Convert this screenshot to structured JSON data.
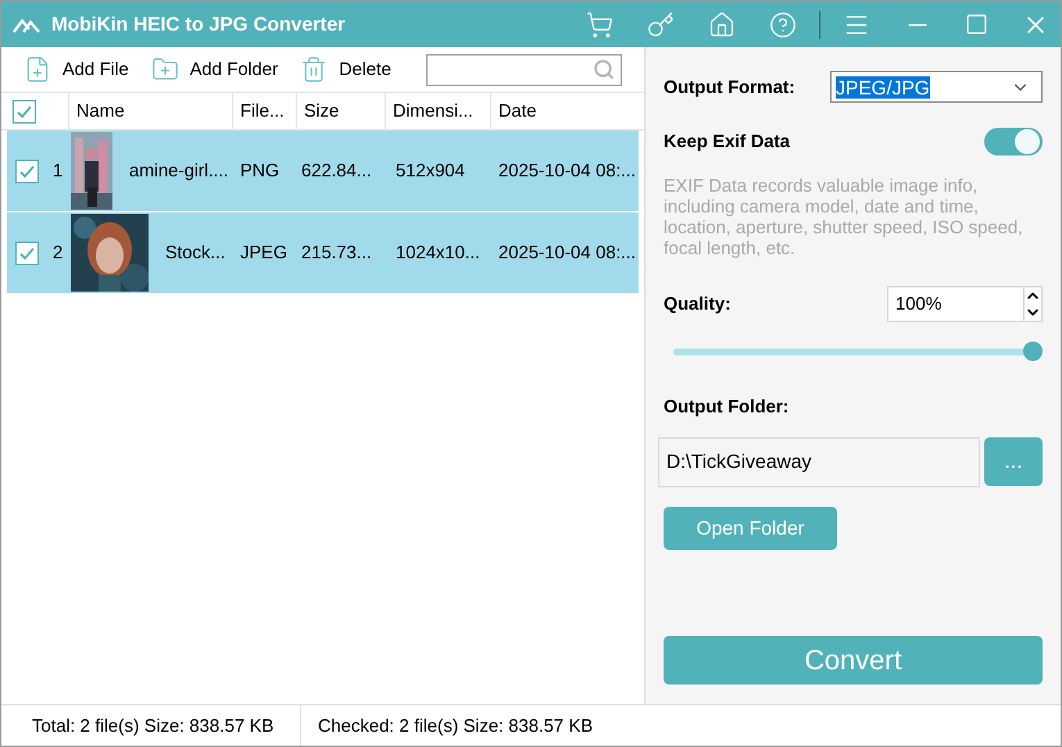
{
  "window": {
    "title": "MobiKin HEIC to JPG Converter"
  },
  "toolbar": {
    "buttons": [
      {
        "kind": "file",
        "label": "Add File"
      },
      {
        "kind": "folder",
        "label": "Add Folder"
      },
      {
        "kind": "delete",
        "label": "Delete"
      }
    ]
  },
  "table": {
    "all_checked": true,
    "columns": [
      "Name",
      "File...",
      "Size",
      "Dimensi...",
      "Date"
    ],
    "rows": [
      {
        "checked": true,
        "selected": true,
        "index": "1",
        "kind": "tall",
        "name": "amine-girl....",
        "type": "PNG",
        "size": "622.84...",
        "dimensions": "512x904",
        "date": "2025-10-04 08:..."
      },
      {
        "checked": true,
        "selected": true,
        "index": "2",
        "kind": "square",
        "name": "Stock...",
        "type": "JPEG",
        "size": "215.73...",
        "dimensions": "1024x10...",
        "date": "2025-10-04 08:..."
      }
    ]
  },
  "settings": {
    "format_label": "Output Format:",
    "format_value": "JPEG/JPG",
    "exif_label": "Keep Exif Data",
    "exif_on": true,
    "exif_note": "EXIF Data records valuable image info, including camera model, date and time, location, aperture, shutter speed, ISO speed, focal length, etc.",
    "quality_label": "Quality:",
    "quality_value": "100%",
    "quality": {
      "level": 1
    },
    "folder_label": "Output Folder:",
    "folder_value": "D:\\TickGiveaway",
    "browse_label": "...",
    "open_folder": "Open Folder",
    "convert": "Convert"
  },
  "status_bar": {
    "total": "Total: 2 file(s) Size: 838.57 KB",
    "checked": "Checked: 2 file(s) Size: 838.57 KB"
  }
}
